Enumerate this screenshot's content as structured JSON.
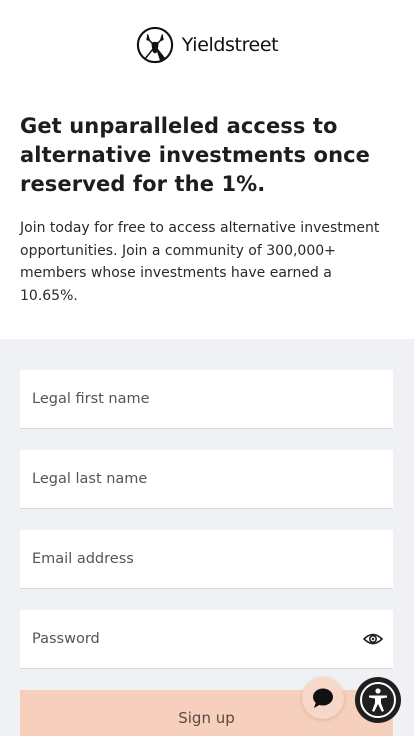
{
  "brand": {
    "name": "Yieldstreet"
  },
  "hero": {
    "headline": "Get unparalleled access to alternative investments once reserved for the 1%.",
    "description": "Join today for free to access alternative investment opportunities. Join a community of 300,000+ members whose investments have earned a 10.65%."
  },
  "form": {
    "first_name_placeholder": "Legal first name",
    "last_name_placeholder": "Legal last name",
    "email_placeholder": "Email address",
    "password_placeholder": "Password",
    "submit_label": "Sign up"
  },
  "icons": {
    "logo": "deer-logo-icon",
    "password_toggle": "eye-icon",
    "chat": "chat-bubble-icon",
    "accessibility": "accessibility-icon"
  },
  "colors": {
    "form_background": "#f0f1f5",
    "signup_button": "#f7d0bd",
    "chat_button": "#f7d8c8",
    "accessibility_button": "#1f1f1f"
  }
}
